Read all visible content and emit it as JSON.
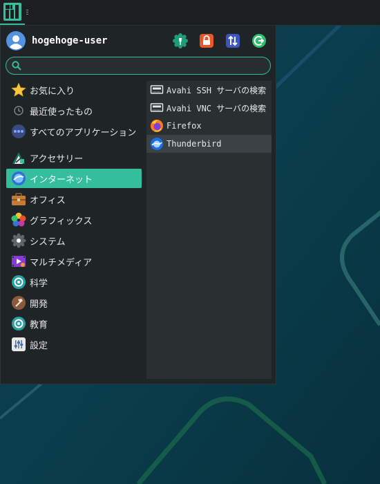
{
  "colors": {
    "accent": "#34be9b",
    "menu_bg": "#1f2426",
    "apps_bg": "#2a3032",
    "desktop": "#0d3a4a"
  },
  "panel": {
    "logo_icon": "manjaro-logo-icon",
    "grip_icon": "panel-grip-icon"
  },
  "header": {
    "username": "hogehoge-user",
    "buttons": [
      {
        "icon": "settings-manager-icon"
      },
      {
        "icon": "lock-screen-icon"
      },
      {
        "icon": "switch-user-icon"
      },
      {
        "icon": "logout-icon"
      }
    ]
  },
  "search": {
    "placeholder": "",
    "value": ""
  },
  "categories": [
    {
      "label": "お気に入り",
      "icon": "star-icon"
    },
    {
      "label": "最近使ったもの",
      "icon": "clock-icon"
    },
    {
      "label": "すべてのアプリケーション",
      "icon": "all-apps-icon"
    },
    {
      "label": "アクセサリー",
      "icon": "accessories-icon"
    },
    {
      "label": "インターネット",
      "icon": "internet-icon",
      "selected": true
    },
    {
      "label": "オフィス",
      "icon": "office-icon"
    },
    {
      "label": "グラフィックス",
      "icon": "graphics-icon"
    },
    {
      "label": "システム",
      "icon": "system-icon"
    },
    {
      "label": "マルチメディア",
      "icon": "multimedia-icon"
    },
    {
      "label": "科学",
      "icon": "science-icon"
    },
    {
      "label": "開発",
      "icon": "development-icon"
    },
    {
      "label": "教育",
      "icon": "education-icon"
    },
    {
      "label": "設定",
      "icon": "settings-icon"
    }
  ],
  "apps": [
    {
      "label": "Avahi SSH サーバの検索",
      "icon": "network-server-icon"
    },
    {
      "label": "Avahi VNC サーバの検索",
      "icon": "network-server-icon"
    },
    {
      "label": "Firefox",
      "icon": "firefox-icon"
    },
    {
      "label": "Thunderbird",
      "icon": "thunderbird-icon",
      "hover": true
    }
  ]
}
